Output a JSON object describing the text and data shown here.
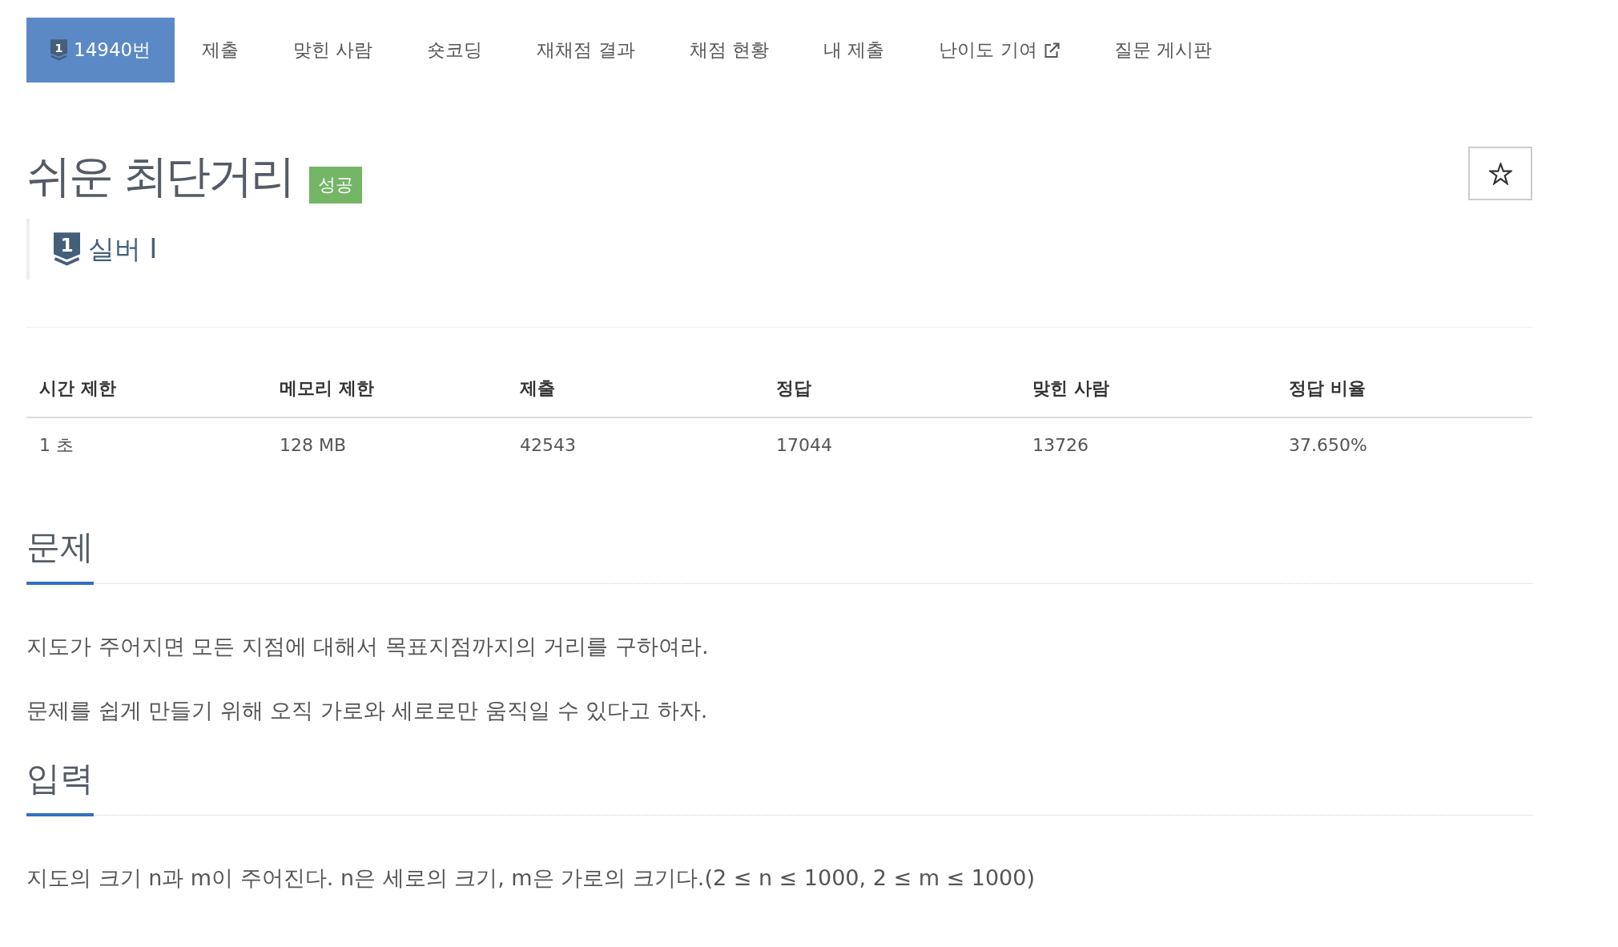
{
  "nav": {
    "tabs": [
      {
        "label": "14940번",
        "selected": true,
        "kind": "problem",
        "tier_badge": "1"
      },
      {
        "label": "제출",
        "selected": false,
        "kind": "page"
      },
      {
        "label": "맞힌 사람",
        "selected": false,
        "kind": "page"
      },
      {
        "label": "숏코딩",
        "selected": false,
        "kind": "page"
      },
      {
        "label": "재채점 결과",
        "selected": false,
        "kind": "page"
      },
      {
        "label": "채점 현황",
        "selected": false,
        "kind": "page"
      },
      {
        "label": "내 제출",
        "selected": false,
        "kind": "page"
      },
      {
        "label": "난이도 기여",
        "selected": false,
        "kind": "external"
      },
      {
        "label": "질문 게시판",
        "selected": false,
        "kind": "page"
      }
    ]
  },
  "problem": {
    "title": "쉬운 최단거리",
    "result": {
      "label": "성공"
    },
    "tier": {
      "badge": "1",
      "label": "실버 I"
    },
    "favorite": {
      "starred": false
    }
  },
  "info_table": {
    "columns": [
      "시간 제한",
      "메모리 제한",
      "제출",
      "정답",
      "맞힌 사람",
      "정답 비율"
    ],
    "rows": [
      [
        "1 초",
        "128 MB",
        "42543",
        "17044",
        "13726",
        "37.650%"
      ]
    ]
  },
  "sections": [
    {
      "title": "문제",
      "paragraphs": [
        "지도가 주어지면 모든 지점에 대해서 목표지점까지의 거리를 구하여라.",
        "문제를 쉽게 만들기 위해 오직 가로와 세로로만 움직일 수 있다고 하자."
      ]
    },
    {
      "title": "입력",
      "paragraphs": [
        "지도의 크기 n과 m이 주어진다. n은 세로의 크기, m은 가로의 크기다.(2 ≤ n ≤ 1000, 2 ≤ m ≤ 1000)"
      ]
    }
  ]
}
